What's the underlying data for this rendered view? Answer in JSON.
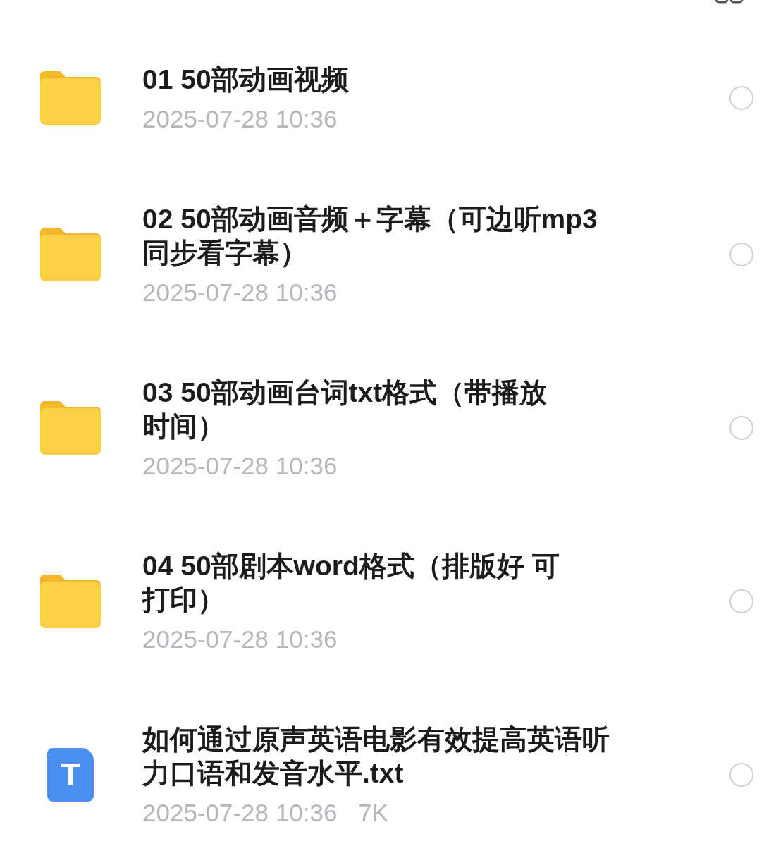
{
  "files": [
    {
      "kind": "folder",
      "title_lines": [
        "01 50部动画视频"
      ],
      "date": "2025-07-28 10:36",
      "selected": false
    },
    {
      "kind": "folder",
      "title_lines": [
        "02 50部动画音频＋字幕（可边听mp3",
        "同步看字幕）"
      ],
      "date": "2025-07-28 10:36",
      "selected": false
    },
    {
      "kind": "folder",
      "title_lines": [
        "03 50部动画台词txt格式（带播放",
        "时间）"
      ],
      "date": "2025-07-28 10:36",
      "selected": false
    },
    {
      "kind": "folder",
      "title_lines": [
        "04 50部剧本word格式（排版好 可",
        "打印）"
      ],
      "date": "2025-07-28 10:36",
      "selected": false
    },
    {
      "kind": "text",
      "icon_letter": "T",
      "title_lines": [
        "如何通过原声英语电影有效提高英语听",
        "力口语和发音水平.txt"
      ],
      "date": "2025-07-28 10:36",
      "size": "7K",
      "selected": false
    }
  ]
}
